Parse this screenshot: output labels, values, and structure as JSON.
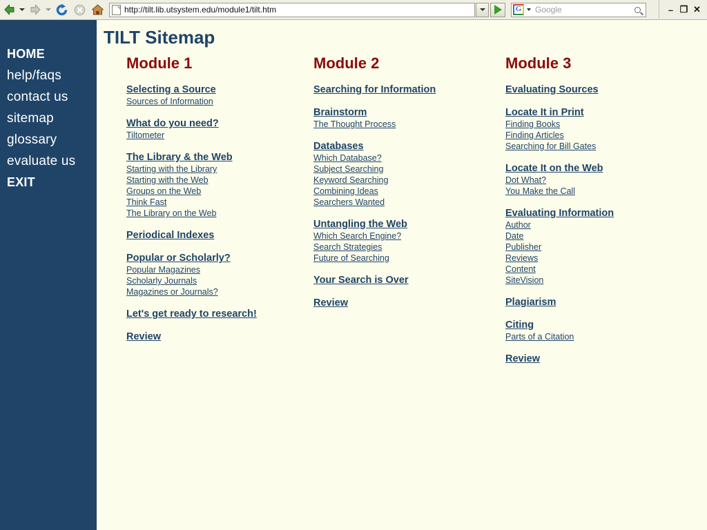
{
  "browser": {
    "back_icon": "back-arrow-icon",
    "forward_icon": "forward-arrow-icon",
    "reload_icon": "reload-icon",
    "stop_icon": "stop-icon",
    "home_icon": "home-icon",
    "url": "http://tilt.lib.utsystem.edu/module1/tilt.htm",
    "search_placeholder": "Google",
    "search_value": "",
    "search_engine": "G",
    "minimize_label": "–",
    "restore_label": "❐",
    "close_label": "✕"
  },
  "colors": {
    "sidebar_bg": "#1f4468",
    "page_bg": "#fdfdec",
    "title_blue": "#1f4468",
    "module_red": "#8b0b0b",
    "link_blue": "#1f4468"
  },
  "sidebar": {
    "items": [
      {
        "label": "HOME",
        "bold": true
      },
      {
        "label": "help/faqs",
        "bold": false
      },
      {
        "label": "contact us",
        "bold": false
      },
      {
        "label": "sitemap",
        "bold": false
      },
      {
        "label": "glossary",
        "bold": false
      },
      {
        "label": "evaluate us",
        "bold": false
      },
      {
        "label": "EXIT",
        "bold": true
      }
    ]
  },
  "main": {
    "title": "TILT Sitemap",
    "columns": [
      {
        "module_title": "Module 1",
        "groups": [
          {
            "main": "Selecting a Source",
            "subs": [
              "Sources of Information"
            ]
          },
          {
            "main": "What do you need?",
            "subs": [
              "Tiltometer"
            ]
          },
          {
            "main": "The Library & the Web",
            "subs": [
              "Starting with the Library",
              "Starting with the Web",
              "Groups on the Web",
              "Think Fast",
              "The Library on the Web"
            ]
          },
          {
            "main": "Periodical Indexes",
            "subs": []
          },
          {
            "main": "Popular or Scholarly?",
            "subs": [
              "Popular Magazines",
              "Scholarly Journals",
              "Magazines or Journals?"
            ]
          },
          {
            "main": "Let's get ready to research!",
            "subs": []
          },
          {
            "main": "Review",
            "subs": []
          }
        ]
      },
      {
        "module_title": "Module 2",
        "groups": [
          {
            "main": "Searching for Information",
            "subs": []
          },
          {
            "main": "Brainstorm",
            "subs": [
              "The Thought Process"
            ]
          },
          {
            "main": "Databases",
            "subs": [
              "Which Database?",
              "Subject Searching",
              "Keyword Searching",
              "Combining Ideas",
              "Searchers Wanted"
            ]
          },
          {
            "main": "Untangling the Web",
            "subs": [
              "Which Search Engine?",
              "Search Strategies",
              "Future of Searching"
            ]
          },
          {
            "main": "Your Search is Over",
            "subs": []
          },
          {
            "main": "Review",
            "subs": []
          }
        ]
      },
      {
        "module_title": "Module 3",
        "groups": [
          {
            "main": "Evaluating Sources",
            "subs": []
          },
          {
            "main": "Locate It in Print",
            "subs": [
              "Finding Books",
              "Finding Articles",
              "Searching for Bill Gates"
            ]
          },
          {
            "main": "Locate It on the Web",
            "subs": [
              "Dot What?",
              "You Make the Call"
            ]
          },
          {
            "main": "Evaluating Information",
            "subs": [
              "Author",
              "Date",
              "Publisher",
              "Reviews",
              "Content",
              "SiteVision"
            ]
          },
          {
            "main": "Plagiarism",
            "subs": []
          },
          {
            "main": "Citing",
            "subs": [
              "Parts of a Citation"
            ]
          },
          {
            "main": "Review",
            "subs": []
          }
        ]
      }
    ]
  }
}
